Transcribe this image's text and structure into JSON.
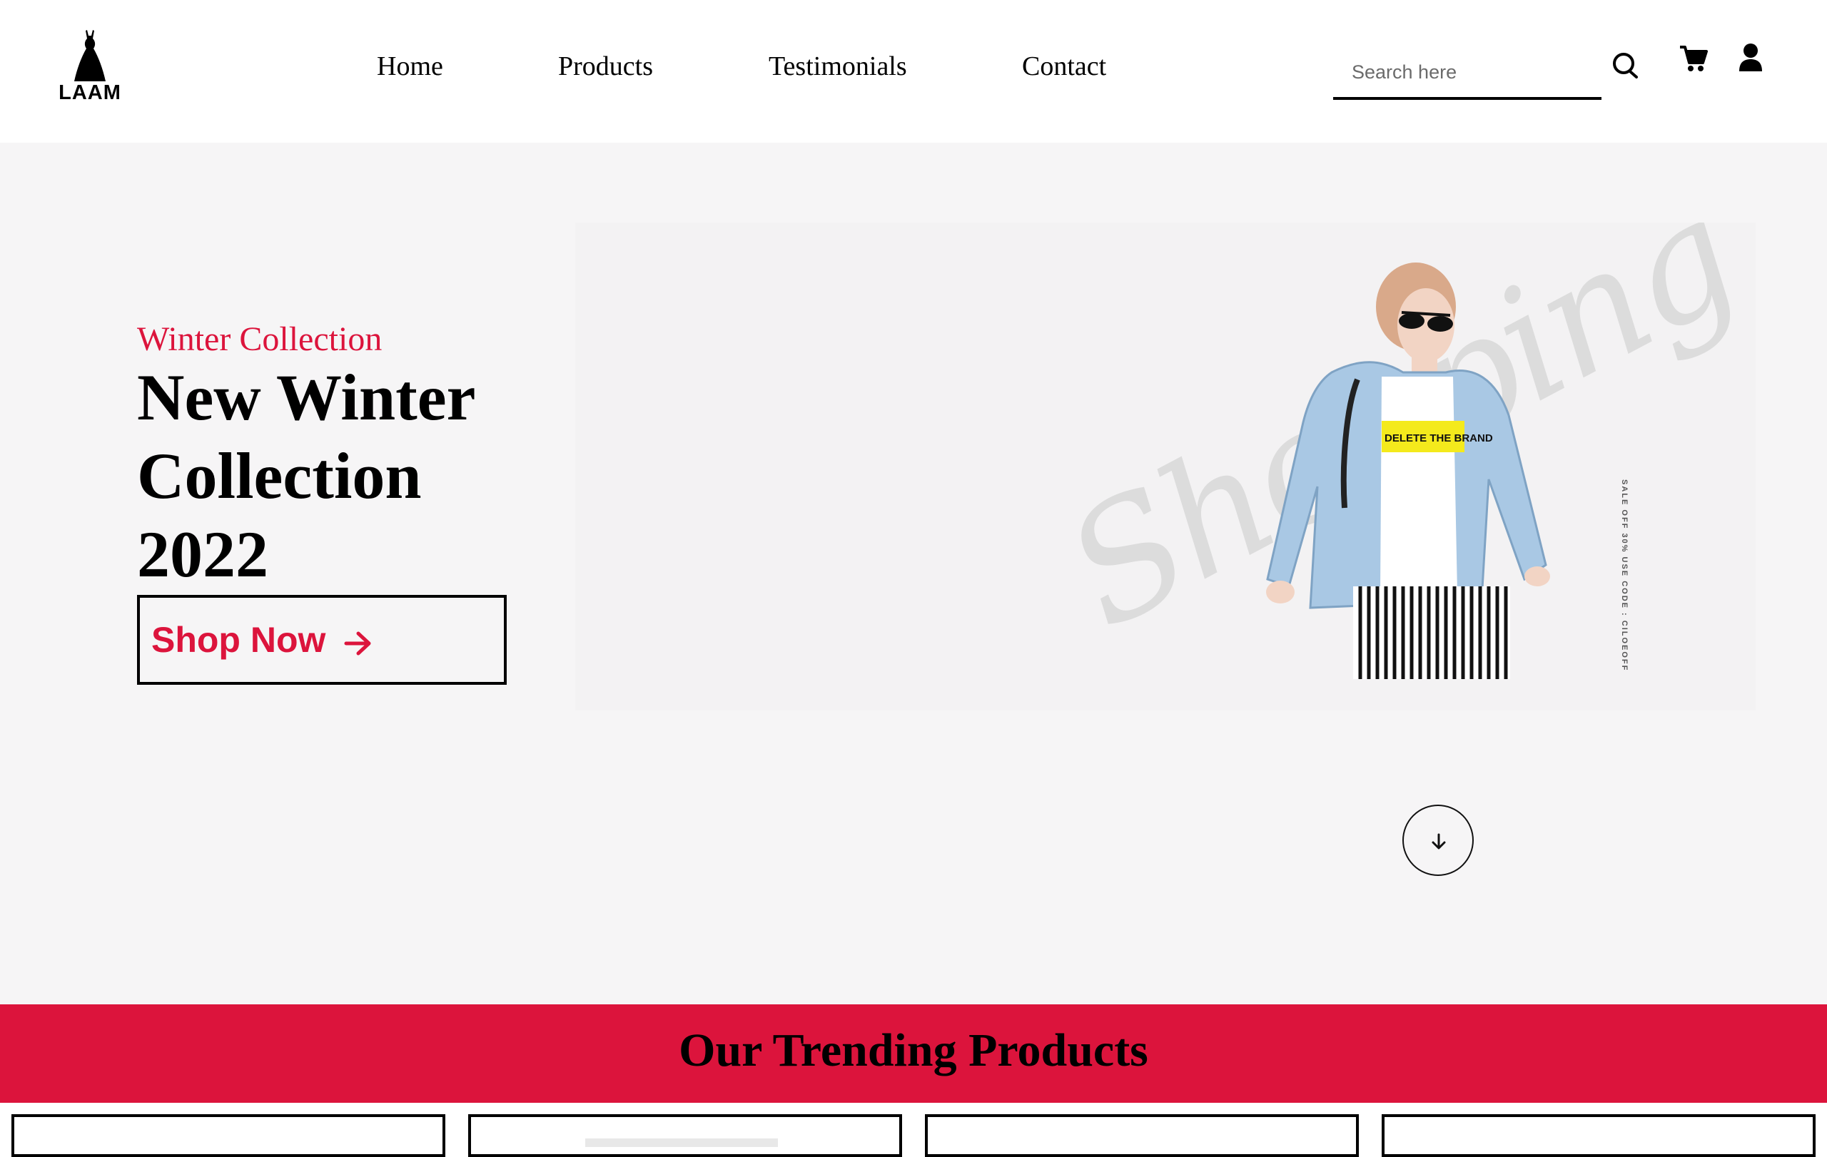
{
  "header": {
    "logo_text": "LAAM",
    "nav": [
      {
        "label": "Home"
      },
      {
        "label": "Products"
      },
      {
        "label": "Testimonials"
      },
      {
        "label": "Contact"
      }
    ],
    "search": {
      "placeholder": "Search here",
      "value": ""
    },
    "icons": [
      "search-icon",
      "cart-icon",
      "user-icon"
    ]
  },
  "hero": {
    "subtitle": "Winter Collection",
    "title": "New Winter\nCollection\n2022",
    "cta_label": "Shop Now",
    "cta_icon": "arrow-right-icon",
    "image": {
      "watermark_text": "Shopping",
      "vertical_text": "SALE OFF 30% USE CODE : CILOEOFF",
      "shirt_text": "DELETE THE BRAND"
    },
    "scroll_icon": "arrow-down-icon"
  },
  "trending": {
    "title": "Our Trending Products",
    "card_count": 4
  },
  "colors": {
    "accent": "#dc143c",
    "hero_bg": "#f6f5f6",
    "text": "#000000"
  }
}
